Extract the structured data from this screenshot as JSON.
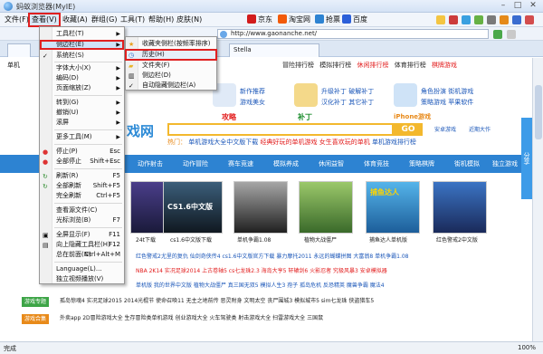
{
  "window": {
    "title": "蚂蚁浏览器(MyIE)"
  },
  "menubar": {
    "items": [
      "文件(F)",
      "查看(V)",
      "收藏(A)",
      "群组(G)",
      "工具(T)",
      "帮助(H)",
      "皮肤(N)"
    ],
    "bookmarks": [
      "京东",
      "淘宝网",
      "抢票",
      "百度"
    ]
  },
  "address": {
    "url": "http://www.gaonanche.net/"
  },
  "tabs": [
    "Stella"
  ],
  "page": {
    "side_tab": "单机",
    "nav_top": [
      "冒险排行榜",
      "模拟排行榜",
      "休闲排行榜",
      "体育排行榜",
      "棋牌游戏",
      "单机游戏",
      "汉化补丁",
      "游戏美女"
    ],
    "banner": [
      {
        "title": "新作推荐",
        "sub": "游戏美女"
      },
      {
        "title": "升级补丁 破解补丁",
        "sub": "汉化补丁 其它补丁"
      },
      {
        "title": "角色扮演 街机游戏",
        "sub": "策略游戏 苹果软件"
      }
    ],
    "banner_labels": [
      "攻略",
      "补丁",
      "iPhone游戏"
    ],
    "search_go": "GO",
    "hot_prefix": "热门：",
    "hot_items": [
      "单机游戏大全中文版下载",
      "经典好玩的单机游戏",
      "女生喜欢玩的单机",
      "单机游戏排行榜"
    ],
    "right_links": [
      "安卓游戏",
      "近期大作"
    ],
    "blue_nav": [
      "首页",
      "动作射击",
      "动作冒险",
      "赛车竞速",
      "模拟养成",
      "休闲益智",
      "体育竞技",
      "策略棋牌",
      "街机模拟",
      "独立游戏"
    ],
    "thumbs": [
      {
        "cap": "24t下载"
      },
      {
        "cap": "cs1.6中文版下载"
      },
      {
        "cap": "单机争霸1.08"
      },
      {
        "cap": "植物大战僵尸"
      },
      {
        "cap": "捕鱼达人单机版"
      },
      {
        "cap": "红色警戒2中文版"
      }
    ],
    "thumb_labels": [
      "CS1.6中文版",
      "捕鱼达人"
    ],
    "rows": [
      {
        "label": "",
        "text": "红色警戒2尤里的复仇  仙剑奇侠传4  cs1.6中文版官方下载  暴力摩托2011  永远的蝴蝶拼图  大富翁8  单机争霸1.08"
      },
      {
        "label": "",
        "text": "NBA 2K14  实况足球2014  上古卷轴5  cs七龙珠2.3  海岛大亨5  轩辕剑6  火影忍者  究极风暴3  安卓模拟器"
      },
      {
        "label": "",
        "text": "单机版  我的世界中文版  植物大战僵尸  真三国无双5  模拟人生3  孢子  孤岛危机  反恐精英  魔兽争霸  魔法4"
      },
      {
        "label": "游戏专题",
        "text": "孤岛惊魂4  实况足球2015  2014光棍节  使命召唤11  无主之地前传  恶灵附身  文明太空  丧尸围城3  模拟城市5  sim七龙珠  侠盗猎车5"
      },
      {
        "label": "游戏合集",
        "text": "外卖app  2D冒险游戏大全  生存冒险类单机游戏  创业游戏大全  火车驾驶类  射击游戏大全  扫雷游戏大全  三国鼠"
      }
    ]
  },
  "menu_view": {
    "items": [
      {
        "label": "工具栏(T)",
        "sc": "",
        "arrow": true
      },
      {
        "label": "侧边栏(E)",
        "sc": "",
        "arrow": true
      },
      {
        "label": "系统栏(S)",
        "sc": "",
        "arrow": false
      },
      {
        "label": "字体大小(X)",
        "sc": "",
        "arrow": true
      },
      {
        "label": "编码(D)",
        "sc": "",
        "arrow": true
      },
      {
        "label": "页面缩放(Z)",
        "sc": "",
        "arrow": true
      },
      {
        "label": "转到(G)",
        "sc": "",
        "arrow": true
      },
      {
        "label": "撤销(U)",
        "sc": "",
        "arrow": true
      },
      {
        "label": "滚屏",
        "sc": "",
        "arrow": true
      },
      {
        "label": "更多工具(M)",
        "sc": "",
        "arrow": true
      },
      {
        "label": "停止(P)",
        "sc": "Esc",
        "arrow": false
      },
      {
        "label": "全部停止",
        "sc": "Shift+Esc",
        "arrow": false
      },
      {
        "label": "刷新(R)",
        "sc": "F5",
        "arrow": false
      },
      {
        "label": "全部刷新",
        "sc": "Shift+F5",
        "arrow": false
      },
      {
        "label": "完全刷新",
        "sc": "Ctrl+F5",
        "arrow": false
      },
      {
        "label": "查看源文件(C)",
        "sc": "",
        "arrow": false
      },
      {
        "label": "光标浏览(B)",
        "sc": "F7",
        "arrow": false
      },
      {
        "label": "全屏显示(F)",
        "sc": "F11",
        "arrow": false
      },
      {
        "label": "向上隐藏工具栏(H)",
        "sc": "F12",
        "arrow": false
      },
      {
        "label": "总在前面(N)",
        "sc": "Ctrl+Alt+M",
        "arrow": false
      },
      {
        "label": "Language(L)...",
        "sc": "",
        "arrow": false
      },
      {
        "label": "独立视频播放(V)",
        "sc": "",
        "arrow": false
      }
    ]
  },
  "menu_sidebar": {
    "items": [
      "收藏夹侧栏(按频率排序)(W)",
      "历史(H)",
      "文件夹(F)",
      "侧边栏(D)",
      "自动隐藏侧边栏(A)"
    ]
  },
  "status": {
    "text": "完成",
    "zoom": "100%"
  }
}
